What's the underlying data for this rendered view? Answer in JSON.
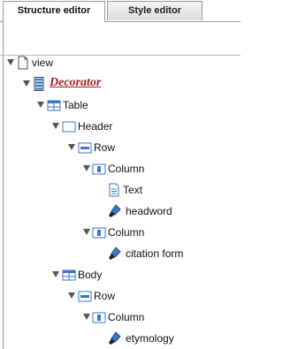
{
  "tabs": [
    {
      "label": "Structure editor",
      "active": true
    },
    {
      "label": "Style editor",
      "active": false
    }
  ],
  "tree": [
    {
      "label": "view",
      "icon": "document-icon",
      "depth": 0
    },
    {
      "label": "Decorator",
      "icon": "decorator-icon",
      "depth": 1
    },
    {
      "label": "Table",
      "icon": "table-icon",
      "depth": 2
    },
    {
      "label": "Header",
      "icon": "header-icon",
      "depth": 3
    },
    {
      "label": "Row",
      "icon": "row-icon",
      "depth": 4
    },
    {
      "label": "Column",
      "icon": "column-icon",
      "depth": 5
    },
    {
      "label": "Text",
      "icon": "text-icon",
      "depth": 6
    },
    {
      "label": "headword",
      "icon": "field-icon",
      "depth": 6
    },
    {
      "label": "Column",
      "icon": "column-icon",
      "depth": 5
    },
    {
      "label": "citation form",
      "icon": "field-icon",
      "depth": 6
    },
    {
      "label": "Body",
      "icon": "table-icon",
      "depth": 3
    },
    {
      "label": "Row",
      "icon": "row-icon",
      "depth": 4
    },
    {
      "label": "Column",
      "icon": "column-icon",
      "depth": 5
    },
    {
      "label": "etymology",
      "icon": "field-icon",
      "depth": 6
    }
  ],
  "colors": {
    "decorator": "#a32020",
    "icon_blue": "#3a78c8"
  }
}
